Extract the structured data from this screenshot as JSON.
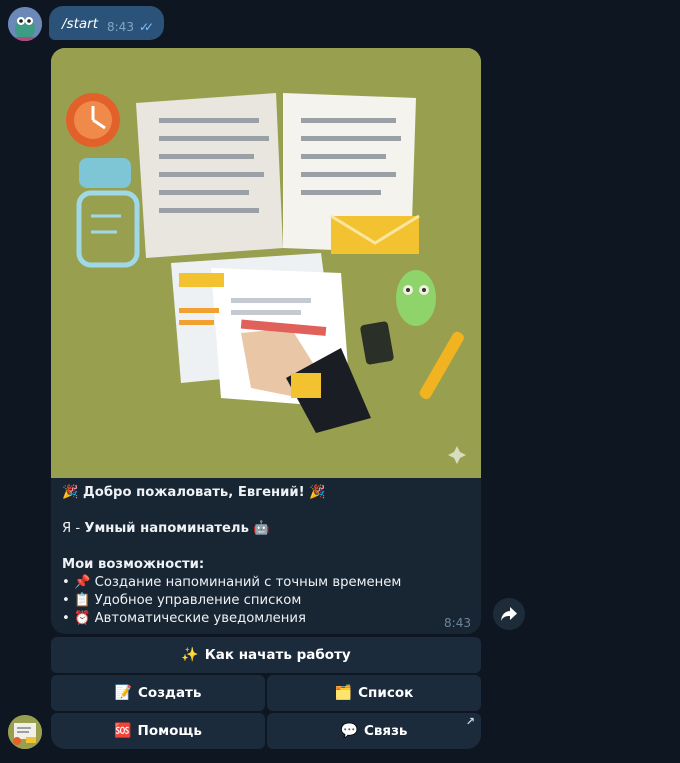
{
  "outgoing": {
    "text": "/start",
    "time": "8:43"
  },
  "bot_message": {
    "greeting_emoji": "🎉",
    "greeting": "Добро пожаловать, Евгений!",
    "intro_prefix": "Я - ",
    "intro_name": "Умный напоминатель",
    "intro_emoji": "🤖",
    "features_title": "Мои возможности:",
    "features": [
      {
        "emoji": "📌",
        "text": "Создание напоминаний с точным временем"
      },
      {
        "emoji": "📋",
        "text": "Удобное управление списком"
      },
      {
        "emoji": "⏰",
        "text": "Автоматические уведомления"
      }
    ],
    "time": "8:43"
  },
  "keyboard": {
    "how": {
      "emoji": "✨",
      "label": "Как начать работу"
    },
    "create": {
      "emoji": "📝",
      "label": "Создать"
    },
    "list": {
      "emoji": "🗂️",
      "label": "Список"
    },
    "help": {
      "emoji": "🆘",
      "label": "Помощь"
    },
    "contact": {
      "emoji": "💬",
      "label": "Связь"
    }
  },
  "colors": {
    "background": "#0e1621",
    "bubble_out": "#2b5278",
    "bubble_in": "#182533",
    "photo_bg": "#98a04f"
  }
}
